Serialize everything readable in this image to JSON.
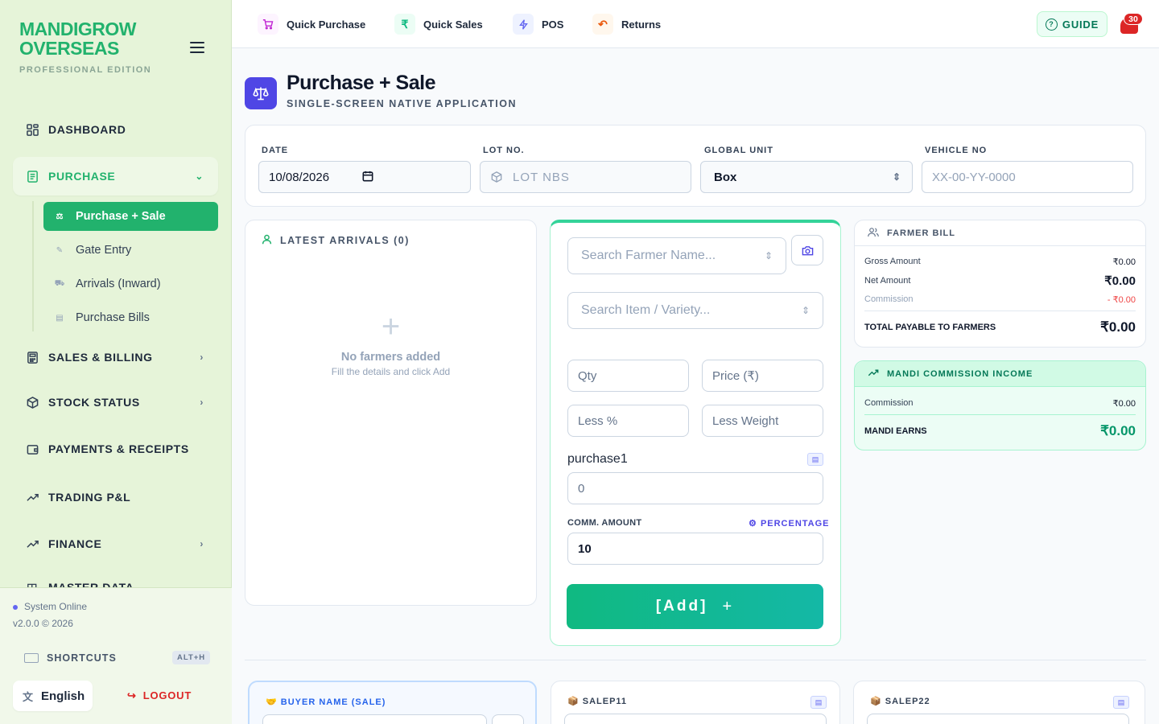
{
  "sidebar": {
    "brand_line1": "MANDIGROW",
    "brand_line2": "OVERSEAS",
    "edition": "PROFESSIONAL EDITION",
    "nav": {
      "dashboard": "DASHBOARD",
      "purchase": "PURCHASE",
      "sales": "SALES & BILLING",
      "stock": "STOCK STATUS",
      "payments": "PAYMENTS & RECEIPTS",
      "trading": "TRADING P&L",
      "finance": "FINANCE",
      "master": "MASTER DATA"
    },
    "purchase_sub": {
      "purchase_sale": "Purchase + Sale",
      "gate_entry": "Gate Entry",
      "arrivals": "Arrivals (Inward)",
      "bills": "Purchase Bills"
    },
    "footer": {
      "status": "System Online",
      "version": "v2.0.0 © 2026",
      "shortcuts": "SHORTCUTS",
      "shortcut_key": "ALT+H",
      "language": "English",
      "logout": "LOGOUT"
    }
  },
  "topbar": {
    "quick_purchase": "Quick Purchase",
    "quick_sales": "Quick Sales",
    "pos": "POS",
    "returns": "Returns",
    "guide": "GUIDE",
    "notifications": "30"
  },
  "page": {
    "title": "Purchase + Sale",
    "subtitle": "SINGLE-SCREEN NATIVE APPLICATION"
  },
  "header_form": {
    "date_label": "DATE",
    "date_value": "10/08/2026",
    "lot_label": "LOT NO.",
    "lot_placeholder": "LOT NBS",
    "unit_label": "GLOBAL UNIT",
    "unit_value": "Box",
    "vehicle_label": "VEHICLE NO",
    "vehicle_placeholder": "XX-00-YY-0000"
  },
  "arrivals": {
    "title": "LATEST ARRIVALS (0)",
    "empty_title": "No farmers added",
    "empty_sub": "Fill the details and click Add"
  },
  "entry": {
    "farmer_placeholder": "Search Farmer Name...",
    "item_placeholder": "Search Item / Variety...",
    "qty_placeholder": "Qty",
    "price_placeholder": "Price (₹)",
    "less_pct_placeholder": "Less %",
    "less_weight_placeholder": "Less Weight",
    "purchase_label": "purchase1",
    "purchase_value": "0",
    "comm_label": "COMM. AMOUNT",
    "comm_mode": "PERCENTAGE",
    "comm_value": "10",
    "add_label": "[Add]"
  },
  "farmer_bill": {
    "title": "FARMER BILL",
    "gross_label": "Gross Amount",
    "gross_value": "₹0.00",
    "net_label": "Net Amount",
    "net_value": "₹0.00",
    "commission_label": "Commission",
    "commission_value": "- ₹0.00",
    "total_label": "TOTAL PAYABLE TO FARMERS",
    "total_value": "₹0.00"
  },
  "mandi_income": {
    "title": "MANDI COMMISSION INCOME",
    "commission_label": "Commission",
    "commission_value": "₹0.00",
    "earns_label": "MANDI EARNS",
    "earns_value": "₹0.00"
  },
  "sale_section": {
    "buyer_title": "🤝 BUYER NAME (SALE)",
    "sale1_title": "📦 SALEP11",
    "sale2_title": "📦 SALEP22"
  },
  "colors": {
    "brand_green": "#22b26d",
    "accent_indigo": "#4f46e5",
    "danger": "#dc2626",
    "sidebar_bg": "#e6f4d9"
  }
}
